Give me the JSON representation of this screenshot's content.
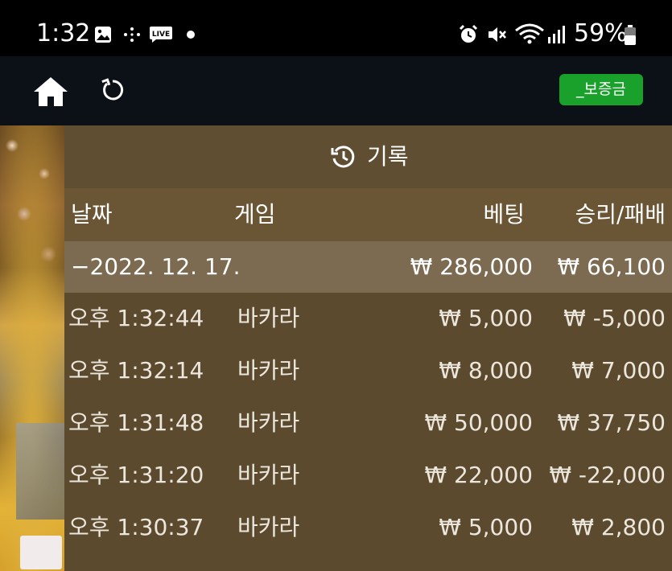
{
  "status_bar": {
    "time": "1:32",
    "battery_percent": "59%",
    "live_badge": "LIVE",
    "icons": [
      "image-icon",
      "sparkle-icon",
      "live-icon",
      "dot-icon",
      "alarm-icon",
      "mute-icon",
      "wifi-icon",
      "signal-icon",
      "battery-icon"
    ]
  },
  "nav": {
    "deposit_label": "_보증금",
    "accent": "#1aa12b",
    "icons": [
      "home-icon",
      "refresh-icon"
    ]
  },
  "history": {
    "title": "기록",
    "columns": {
      "date": "날짜",
      "game": "게임",
      "bet": "베팅",
      "win_loss": "승리/패배"
    },
    "date_group": {
      "date": "−2022. 12. 17.",
      "bet_total": "₩ 286,000",
      "win_loss_total": "₩ 66,100"
    },
    "rows": [
      {
        "time": "오후 1:32:44",
        "game": "바카라",
        "bet": "₩ 5,000",
        "result": "₩ -5,000"
      },
      {
        "time": "오후 1:32:14",
        "game": "바카라",
        "bet": "₩ 8,000",
        "result": "₩ 7,000"
      },
      {
        "time": "오후 1:31:48",
        "game": "바카라",
        "bet": "₩ 50,000",
        "result": "₩ 37,750"
      },
      {
        "time": "오후 1:31:20",
        "game": "바카라",
        "bet": "₩ 22,000",
        "result": "₩ -22,000"
      },
      {
        "time": "오후 1:30:37",
        "game": "바카라",
        "bet": "₩ 5,000",
        "result": "₩ 2,800"
      }
    ]
  }
}
